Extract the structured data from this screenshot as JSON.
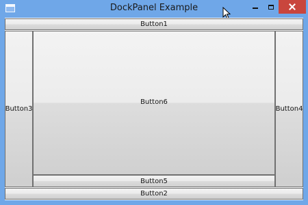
{
  "window": {
    "title": "DockPanel Example"
  },
  "buttons": {
    "button1": "Button1",
    "button2": "Button2",
    "button3": "Button3",
    "button4": "Button4",
    "button5": "Button5",
    "button6": "Button6"
  },
  "colors": {
    "titlebar": "#6fa7e8",
    "close": "#c9463d",
    "button_border": "#707070"
  },
  "icons": [
    "app-icon",
    "minimize-icon",
    "maximize-icon",
    "close-icon",
    "mouse-cursor-icon"
  ]
}
